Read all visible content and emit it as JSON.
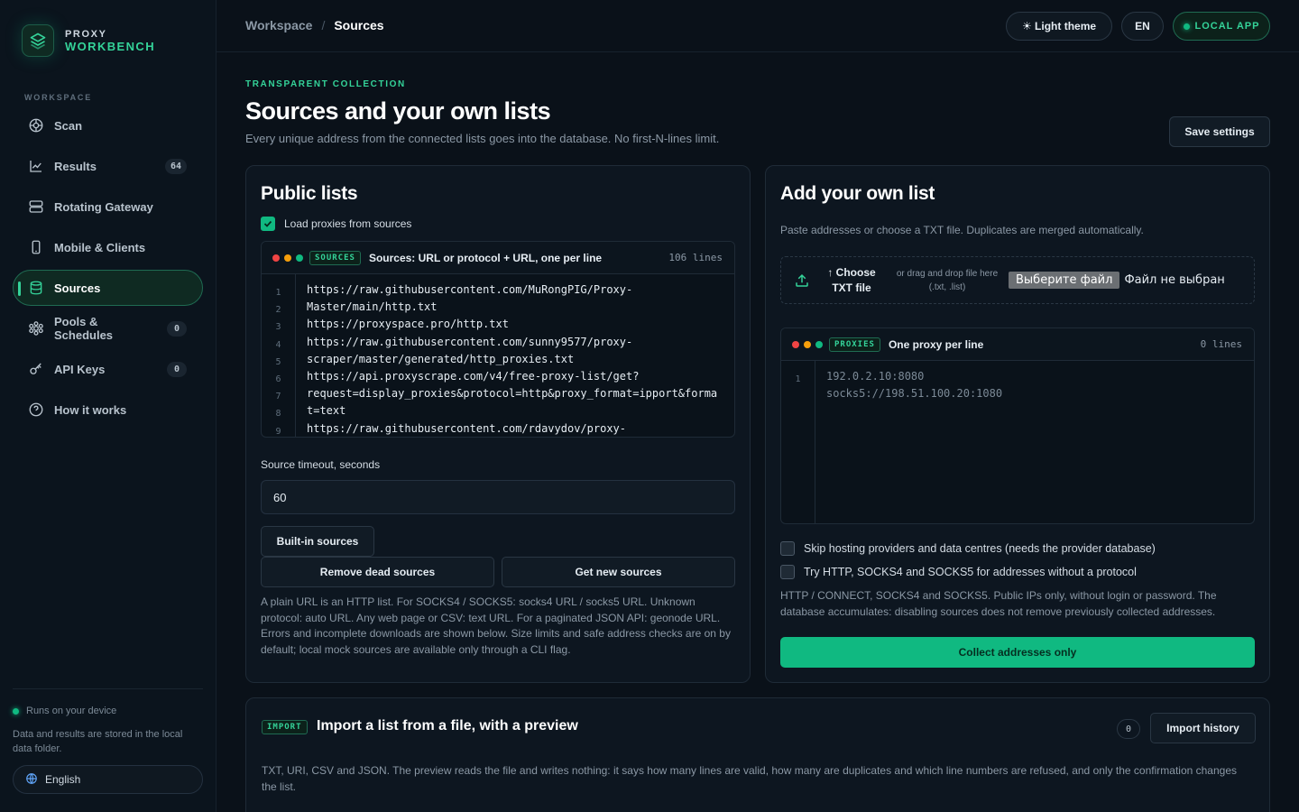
{
  "brand": {
    "line1": "PROXY",
    "line2": "WORKBENCH"
  },
  "sidebar": {
    "section_label": "WORKSPACE",
    "items": [
      {
        "label": "Scan",
        "icon": "scan-icon",
        "badge": null
      },
      {
        "label": "Results",
        "icon": "chart-icon",
        "badge": "64"
      },
      {
        "label": "Rotating Gateway",
        "icon": "server-icon",
        "badge": null
      },
      {
        "label": "Mobile & Clients",
        "icon": "mobile-icon",
        "badge": null
      },
      {
        "label": "Sources",
        "icon": "database-icon",
        "badge": null,
        "active": true
      },
      {
        "label": "Pools & Schedules",
        "icon": "pools-icon",
        "badge": "0"
      },
      {
        "label": "API Keys",
        "icon": "key-icon",
        "badge": "0"
      },
      {
        "label": "How it works",
        "icon": "help-icon",
        "badge": null
      }
    ],
    "device_status": "Runs on your device",
    "device_note": "Data and results are stored in the local data folder.",
    "language": "English"
  },
  "topbar": {
    "crumb_parent": "Workspace",
    "crumb_current": "Sources",
    "theme_button": "☀ Light theme",
    "lang_button": "EN",
    "local_app": "LOCAL APP"
  },
  "header": {
    "eyebrow": "TRANSPARENT COLLECTION",
    "title": "Sources and your own lists",
    "subtitle": "Every unique address from the connected lists goes into the database. No first-N-lines limit.",
    "save_button": "Save settings"
  },
  "public_lists": {
    "title": "Public lists",
    "load_checkbox": "Load proxies from sources",
    "editor_tag": "SOURCES",
    "editor_label": "Sources: URL or protocol + URL, one per line",
    "editor_count": "106 lines",
    "gutter": [
      "1",
      "2",
      "3",
      "4",
      "5",
      "6",
      "7",
      "8",
      "9"
    ],
    "code": "https://raw.githubusercontent.com/MuRongPIG/Proxy-\nMaster/main/http.txt\nhttps://proxyspace.pro/http.txt\nhttps://raw.githubusercontent.com/sunny9577/proxy-\nscraper/master/generated/http_proxies.txt\nhttps://api.proxyscrape.com/v4/free-proxy-list/get?\nrequest=display_proxies&protocol=http&proxy_format=ipport&forma\nt=text\nhttps://raw.githubusercontent.com/rdavydov/proxy-",
    "timeout_label": "Source timeout, seconds",
    "timeout_value": "60",
    "builtin_button": "Built-in sources",
    "remove_button": "Remove dead sources",
    "get_button": "Get new sources",
    "help": "A plain URL is an HTTP list. For SOCKS4 / SOCKS5: socks4 URL / socks5 URL. Unknown protocol: auto URL. Any web page or CSV: text URL. For a paginated JSON API: geonode URL. Errors and incomplete downloads are shown below. Size limits and safe address checks are on by default; local mock sources are available only through a CLI flag."
  },
  "own_list": {
    "title": "Add your own list",
    "subtitle": "Paste addresses or choose a TXT file. Duplicates are merged automatically.",
    "choose_line1": "↑ Choose",
    "choose_line2": "TXT file",
    "drag_text": "or drag and drop file here (.txt, .list)",
    "file_button": "Выберите файл",
    "file_none": "Файл не выбран",
    "editor_tag": "PROXIES",
    "editor_label": "One proxy per line",
    "editor_count": "0 lines",
    "gutter": [
      "1"
    ],
    "placeholder": "192.0.2.10:8080\nsocks5://198.51.100.20:1080",
    "skip_hosting": "Skip hosting providers and data centres (needs the provider database)",
    "try_protocols": "Try HTTP, SOCKS4 and SOCKS5 for addresses without a protocol",
    "help": "HTTP / CONNECT, SOCKS4 and SOCKS5. Public IPs only, without login or password. The database accumulates: disabling sources does not remove previously collected addresses.",
    "collect_button": "Collect addresses only"
  },
  "import": {
    "tag": "IMPORT",
    "title": "Import a list from a file, with a preview",
    "count": "0",
    "history_button": "Import history",
    "text": "TXT, URI, CSV and JSON. The preview reads the file and writes nothing: it says how many lines are valid, how many are duplicates and which line numbers are refused, and only the confirmation changes the list."
  },
  "colors": {
    "accent": "#10b981",
    "accent_light": "#34d399",
    "background": "#0a1119",
    "card": "#0d1620"
  }
}
